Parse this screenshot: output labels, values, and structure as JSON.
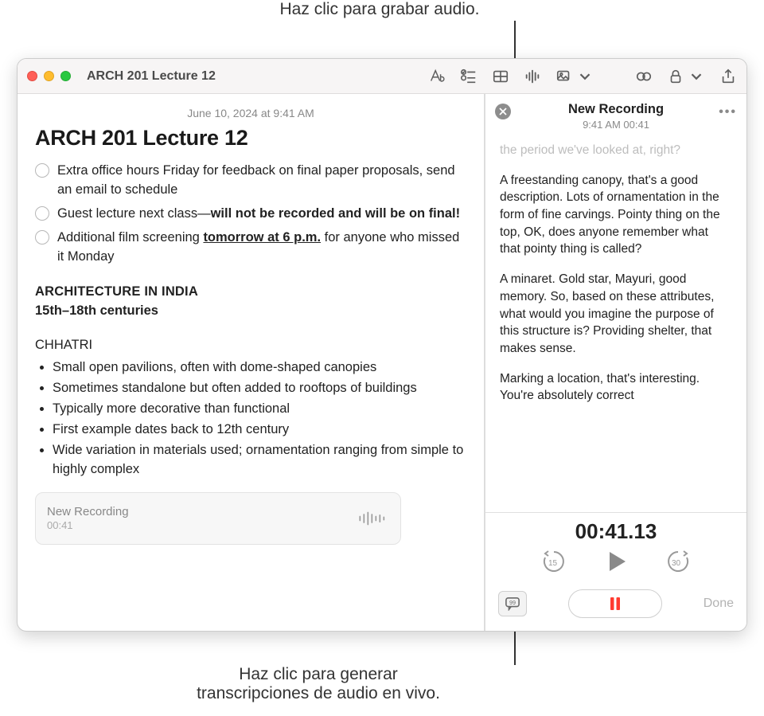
{
  "callouts": {
    "top": "Haz clic para grabar audio.",
    "bottom_l1": "Haz clic para generar",
    "bottom_l2": "transcripciones de audio en vivo."
  },
  "window": {
    "title": "ARCH 201 Lecture 12"
  },
  "note": {
    "timestamp": "June 10, 2024 at 9:41 AM",
    "title": "ARCH 201 Lecture 12",
    "check1_a": "Extra office hours Friday for feedback on final paper proposals, send an email to schedule",
    "check2_a": "Guest lecture next class—",
    "check2_b": "will not be recorded and will be on final!",
    "check3_a": "Additional film screening ",
    "check3_b": "tomorrow at 6 p.m.",
    "check3_c": " for anyone who missed it Monday",
    "section1": "ARCHITECTURE IN INDIA",
    "section1b": "15th–18th centuries",
    "section2": "CHHATRI",
    "bullets": [
      "Small open pavilions, often with dome-shaped canopies",
      "Sometimes standalone but often added to rooftops of buildings",
      "Typically more decorative than functional",
      "First example dates back to 12th century",
      "Wide variation in materials used; ornamentation ranging from simple to highly complex"
    ],
    "rec_card_title": "New Recording",
    "rec_card_time": "00:41"
  },
  "side": {
    "title": "New Recording",
    "subtitle": "9:41 AM 00:41",
    "faded_line": "the period we've looked at, right?",
    "p1": "A freestanding canopy, that's a good description. Lots of ornamentation in the form of fine carvings. Pointy thing on the top, OK, does anyone remember what that pointy thing is called?",
    "p2": "A minaret. Gold star, Mayuri, good memory. So, based on these attributes, what would you imagine the purpose of this structure is? Providing shelter, that makes sense.",
    "p3": "Marking a location, that's interesting. You're absolutely correct",
    "more": "•••"
  },
  "player": {
    "timer": "00:41.13",
    "back": "15",
    "fwd": "30",
    "done": "Done"
  }
}
